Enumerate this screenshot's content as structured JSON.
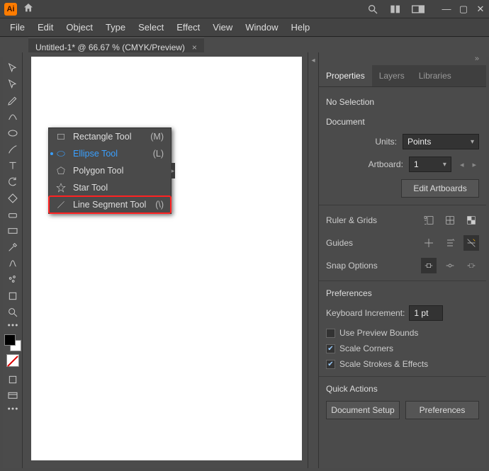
{
  "titlebar": {
    "app_abbrev": "Ai"
  },
  "menu": {
    "file": "File",
    "edit": "Edit",
    "object": "Object",
    "type": "Type",
    "select": "Select",
    "effect": "Effect",
    "view": "View",
    "window": "Window",
    "help": "Help"
  },
  "tabs": {
    "doc1": {
      "label": "Untitled-1* @ 66.67 % (CMYK/Preview)",
      "close": "×"
    }
  },
  "flyout": {
    "rectangle": {
      "label": "Rectangle Tool",
      "key": "(M)"
    },
    "ellipse": {
      "label": "Ellipse Tool",
      "key": "(L)"
    },
    "polygon": {
      "label": "Polygon Tool"
    },
    "star": {
      "label": "Star Tool"
    },
    "line": {
      "label": "Line Segment Tool",
      "key": "(\\)"
    }
  },
  "panels": {
    "properties_tab": "Properties",
    "layers_tab": "Layers",
    "libraries_tab": "Libraries",
    "no_selection": "No Selection",
    "document_hdr": "Document",
    "units_label": "Units:",
    "units_value": "Points",
    "artboard_label": "Artboard:",
    "artboard_value": "1",
    "edit_artboards": "Edit Artboards",
    "ruler_grids": "Ruler & Grids",
    "guides": "Guides",
    "snap_options": "Snap Options",
    "preferences_hdr": "Preferences",
    "kb_inc_label": "Keyboard Increment:",
    "kb_inc_value": "1 pt",
    "use_preview_bounds": "Use Preview Bounds",
    "scale_corners": "Scale Corners",
    "scale_strokes": "Scale Strokes & Effects",
    "quick_actions": "Quick Actions",
    "doc_setup": "Document Setup",
    "prefs_btn": "Preferences"
  }
}
